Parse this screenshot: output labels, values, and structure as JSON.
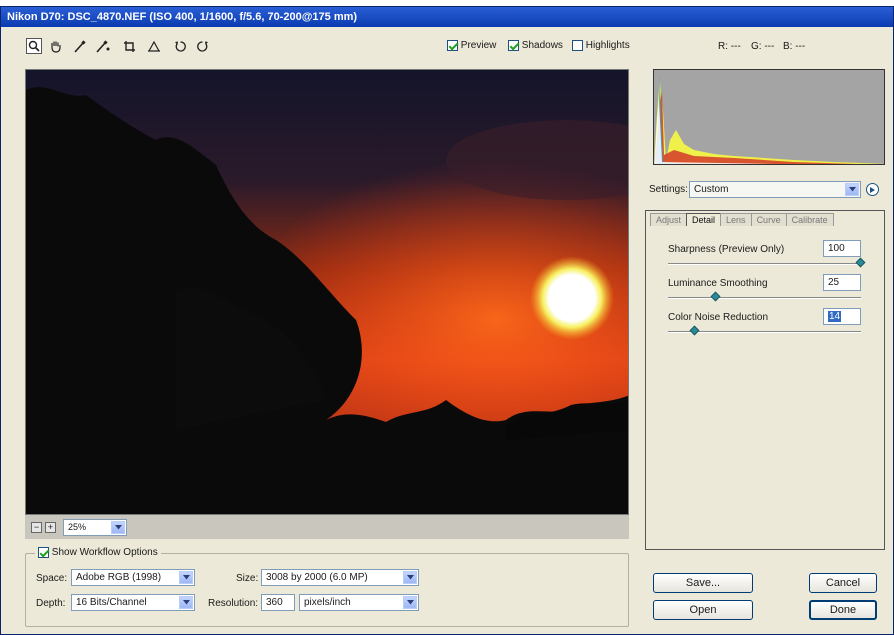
{
  "window": {
    "title": "Nikon D70:  DSC_4870.NEF  (ISO 400, 1/1600, f/5.6, 70-200@175 mm)"
  },
  "toolbar": {
    "tools": [
      "zoom-icon",
      "hand-icon",
      "white-balance-icon",
      "color-sampler-icon",
      "crop-icon",
      "straighten-icon",
      "rotate-left-icon",
      "rotate-right-icon"
    ],
    "preview_label": "Preview",
    "preview_checked": true,
    "shadows_label": "Shadows",
    "shadows_checked": true,
    "highlights_label": "Highlights",
    "highlights_checked": false,
    "rgb_readout": {
      "r": "R: ---",
      "g": "G: ---",
      "b": "B: ---"
    }
  },
  "zoom": {
    "minus": "−",
    "plus": "+",
    "value": "25%"
  },
  "settings": {
    "label": "Settings:",
    "value": "Custom"
  },
  "tabs": [
    {
      "label": "Adjust",
      "active": false
    },
    {
      "label": "Detail",
      "active": true
    },
    {
      "label": "Lens",
      "active": false
    },
    {
      "label": "Curve",
      "active": false
    },
    {
      "label": "Calibrate",
      "active": false
    }
  ],
  "detail": {
    "sharpness": {
      "label": "Sharpness  (Preview Only)",
      "value": "100",
      "level": 1.0
    },
    "luminance": {
      "label": "Luminance Smoothing",
      "value": "25",
      "level": 0.25
    },
    "color_noise": {
      "label": "Color Noise Reduction",
      "value": "14",
      "level": 0.14
    }
  },
  "workflow": {
    "show_label": "Show Workflow Options",
    "show_checked": true,
    "space_label": "Space:",
    "space_value": "Adobe RGB (1998)",
    "size_label": "Size:",
    "size_value": "3008 by 2000  (6.0 MP)",
    "depth_label": "Depth:",
    "depth_value": "16 Bits/Channel",
    "resolution_label": "Resolution:",
    "resolution_value": "360",
    "resolution_unit": "pixels/inch"
  },
  "buttons": {
    "save": "Save...",
    "cancel": "Cancel",
    "open": "Open",
    "done": "Done"
  },
  "colors": {
    "titlebar": "#0b3ab0",
    "accent_check": "#21a121",
    "slider_thumb": "#2a8a9a"
  }
}
